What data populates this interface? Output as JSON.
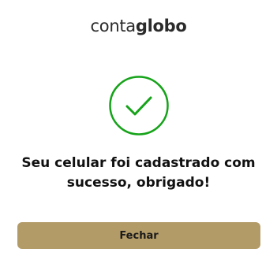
{
  "brand": {
    "logo_light": "conta",
    "logo_bold": "globo"
  },
  "status": {
    "icon": "check-circle-icon",
    "color": "#16a31a"
  },
  "message": {
    "line1": "Seu celular foi cadastrado com",
    "line2": "sucesso, obrigado!"
  },
  "actions": {
    "close_label": "Fechar",
    "button_color": "#b39b68"
  }
}
